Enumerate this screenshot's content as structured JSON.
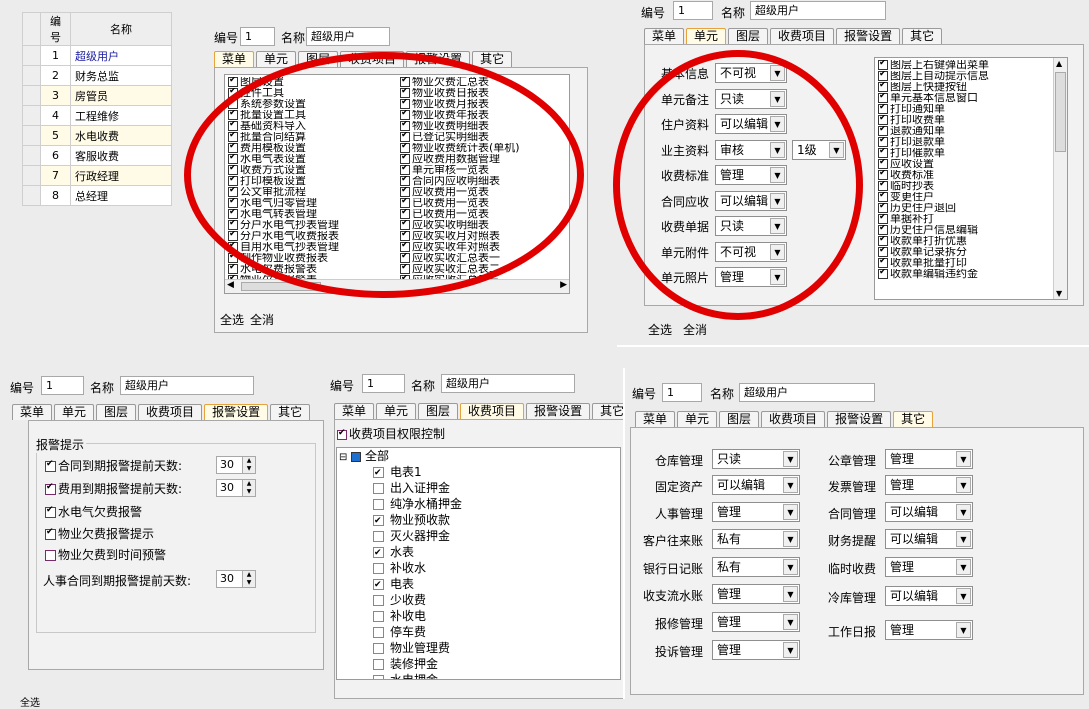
{
  "roles": {
    "headers": [
      "编号",
      "名称"
    ],
    "rows": [
      {
        "num": "1",
        "name": "超级用户"
      },
      {
        "num": "2",
        "name": "财务总监"
      },
      {
        "num": "3",
        "name": "房管员"
      },
      {
        "num": "4",
        "name": "工程维修"
      },
      {
        "num": "5",
        "name": "水电收费"
      },
      {
        "num": "6",
        "name": "客服收费"
      },
      {
        "num": "7",
        "name": "行政经理"
      },
      {
        "num": "8",
        "name": "总经理"
      }
    ]
  },
  "labels": {
    "num": "编号",
    "name": "名称",
    "select_all": "全选",
    "clear_all": "全消"
  },
  "user": {
    "num": "1",
    "name": "超级用户"
  },
  "tabs": [
    "菜单",
    "单元",
    "图层",
    "收费项目",
    "报警设置",
    "其它"
  ],
  "menu_panel": {
    "left_items": [
      "图层设置",
      "控件工具",
      "系统参数设置",
      "批量设置工具",
      "基础资料导入",
      "批量合同结算",
      "费用模板设置",
      "水电气表设置",
      "收费方式设置",
      "打印模板设置",
      "公文审批流程",
      "水电气归零管理",
      "水电气转表管理",
      "分户水电气抄表管理",
      "分户水电气收费报表",
      "自用水电气抄表管理",
      "制作物业收费报表",
      "水电欠费报警表",
      "物业欠费报警表"
    ],
    "right_items": [
      "物业欠费汇总表",
      "物业收费日报表",
      "物业收费月报表",
      "物业收费年报表",
      "物业收费明细表",
      "已登记实明细表",
      "物业收费统计表(单机)",
      "应收费用数据管理",
      "单元审核一览表",
      "合同内应收明细表",
      "应收费用一览表",
      "已收费用一览表",
      "已收费用一览表",
      "应收实收明细表",
      "应收实收月对照表",
      "应收实收年对照表",
      "应收实收汇总表一",
      "应收实收汇总表二",
      "应收实收汇总表三"
    ]
  },
  "unit_panel": {
    "fields": [
      {
        "label": "基本信息",
        "value": "不可视"
      },
      {
        "label": "单元备注",
        "value": "只读"
      },
      {
        "label": "住户资料",
        "value": "可以编辑"
      },
      {
        "label": "业主资料",
        "value": "审核",
        "extra": "1级"
      },
      {
        "label": "收费标准",
        "value": "管理"
      },
      {
        "label": "合同应收",
        "value": "可以编辑"
      },
      {
        "label": "收费单据",
        "value": "只读"
      },
      {
        "label": "单元附件",
        "value": "不可视"
      },
      {
        "label": "单元照片",
        "value": "管理"
      }
    ],
    "perms": [
      "图层上右键弹出菜单",
      "图层上自动提示信息",
      "图层上快捷按钮",
      "单元基本信息窗口",
      "打印通知单",
      "打印收费单",
      "退款通知单",
      "打印退款单",
      "打印催款单",
      "应收设置",
      "收费标准",
      "临时抄表",
      "变更住户",
      "历史住户退回",
      "单据补打",
      "历史住户信息编辑",
      "收款单打折优惠",
      "收款单记录拆分",
      "收款单批量打印",
      "收款单编辑违约金"
    ]
  },
  "alarm_panel": {
    "group": "报警提示",
    "items": [
      {
        "label": "合同到期报警提前天数:",
        "checked": true,
        "days": "30"
      },
      {
        "label": "费用到期报警提前天数:",
        "checked": true,
        "days": "30"
      },
      {
        "label": "水电气欠费报警",
        "checked": true
      },
      {
        "label": "物业欠费报警提示",
        "checked": true
      },
      {
        "label": "物业欠费到时间预警",
        "checked": false
      }
    ],
    "hr_label": "人事合同到期报警提前天数:",
    "hr_days": "30"
  },
  "fee_panel": {
    "control_label": "收费项目权限控制",
    "root": "全部",
    "items": [
      {
        "label": "电表1",
        "checked": true
      },
      {
        "label": "出入证押金",
        "checked": false
      },
      {
        "label": "纯净水桶押金",
        "checked": false
      },
      {
        "label": "物业预收款",
        "checked": true
      },
      {
        "label": "灭火器押金",
        "checked": false
      },
      {
        "label": "水表",
        "checked": true
      },
      {
        "label": "补收水",
        "checked": false
      },
      {
        "label": "电表",
        "checked": true
      },
      {
        "label": "少收费",
        "checked": false
      },
      {
        "label": "补收电",
        "checked": false
      },
      {
        "label": "停车费",
        "checked": false
      },
      {
        "label": "物业管理费",
        "checked": false
      },
      {
        "label": "装修押金",
        "checked": false
      },
      {
        "label": "水电押金",
        "checked": false
      }
    ]
  },
  "other_panel": {
    "left": [
      {
        "label": "仓库管理",
        "value": "只读"
      },
      {
        "label": "固定资产",
        "value": "可以编辑"
      },
      {
        "label": "人事管理",
        "value": "管理"
      },
      {
        "label": "客户往来账",
        "value": "私有"
      },
      {
        "label": "银行日记账",
        "value": "私有"
      },
      {
        "label": "收支流水账",
        "value": "管理"
      },
      {
        "label": "报修管理",
        "value": "管理"
      },
      {
        "label": "投诉管理",
        "value": "管理"
      }
    ],
    "right": [
      {
        "label": "公章管理",
        "value": "管理"
      },
      {
        "label": "发票管理",
        "value": "管理"
      },
      {
        "label": "合同管理",
        "value": "可以编辑"
      },
      {
        "label": "财务提醒",
        "value": "可以编辑"
      },
      {
        "label": "临时收费",
        "value": "管理"
      },
      {
        "label": "冷库管理",
        "value": "可以编辑"
      },
      {
        "label": "工作日报",
        "value": "管理"
      }
    ]
  }
}
